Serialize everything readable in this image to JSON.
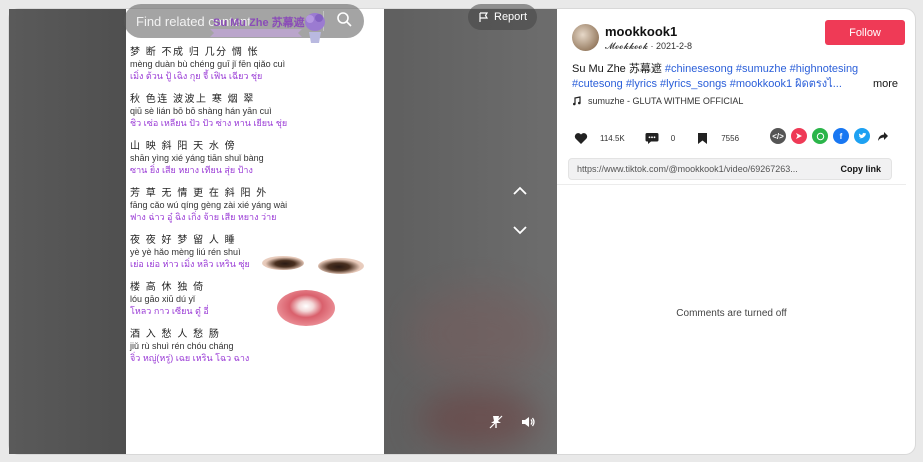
{
  "video": {
    "search_placeholder": "Find related content",
    "report_label": "Report",
    "song_title": "Su Mu Zhe 苏幕遮",
    "lyrics": [
      {
        "zh": "梦 断 不成 归 几分 惆 怅",
        "py": "mèng duàn bù chéng guī  jǐ fēn qiǎo cuì",
        "th": "เมิ่ง ต้วน ปู้ เฉิง กุย จี้ เฟิน เฉียว ชุ่ย"
      },
      {
        "zh": "秋 色连 波波上 寒 烟 翠",
        "py": "qiū sè lián bō bō shàng hán yān cuì",
        "th": "ชิว เซ่อ เหลียน ปัว ปัว ซ่าง หาน เยียน ชุ่ย"
      },
      {
        "zh": "山 映 斜 阳 天 水 傍",
        "py": "shān yìng xié yáng tiān shuǐ bàng",
        "th": "ซาน ยิ่ง เสีย หยาง เทียน สุ่ย ป้าง"
      },
      {
        "zh": "芳 草 无 情    更 在 斜 阳 外",
        "py": "fāng cǎo wú qíng    gèng zài xié yáng wài",
        "th": "ฟาง ฉ่าว อู๋ ฉิง เกิ่ง จ้าย เสีย หยาง ว่าย"
      },
      {
        "zh": "夜 夜 好 梦 留 人 睡",
        "py": "yè yè hǎo mèng liú rén shuì",
        "th": "เย่อ เย่อ ห่าว เมิ่ง หลิว เหริน ซุ่ย"
      },
      {
        "zh": "楼 高 休 独 倚",
        "py": "lóu gāo xiū dú yǐ",
        "th": "โหลว กาว เซียน ตู๋ อี่"
      },
      {
        "zh": "酒 入 愁 人 愁 肠",
        "py": "jiǔ rù shuì rén chóu cháng",
        "th": "จิ่ว หญู่(หรู่) เฉย เหริน โฉว ฉาง"
      }
    ]
  },
  "author": {
    "username": "mookkook1",
    "nickname": "𝓜𝓸𝓸𝓴𝓴𝓸𝓸𝓴",
    "date": "· 2021-2-8",
    "follow_label": "Follow"
  },
  "description": {
    "text": "Su Mu Zhe 苏幕遮",
    "hashtags_line1": "#chinesesong #sumuzhe #highnotesing",
    "hashtags_line2": "#cutesong #lyrics #lyrics_songs #mookkook1 ผิดตรงไ...",
    "more_label": "more"
  },
  "music": {
    "title": "sumuzhe - GLUTA WITHME OFFICIAL"
  },
  "stats": {
    "likes": "114.5K",
    "comments": "0",
    "saves": "7556"
  },
  "share": {
    "url": "https://www.tiktok.com/@mookkook1/video/69267263...",
    "copy_label": "Copy link"
  },
  "comments": {
    "status": "Comments are turned off"
  },
  "colors": {
    "accent": "#ef3a56",
    "hashtag": "#2b5fd9",
    "thai_lyrics": "#9a3bd6"
  }
}
